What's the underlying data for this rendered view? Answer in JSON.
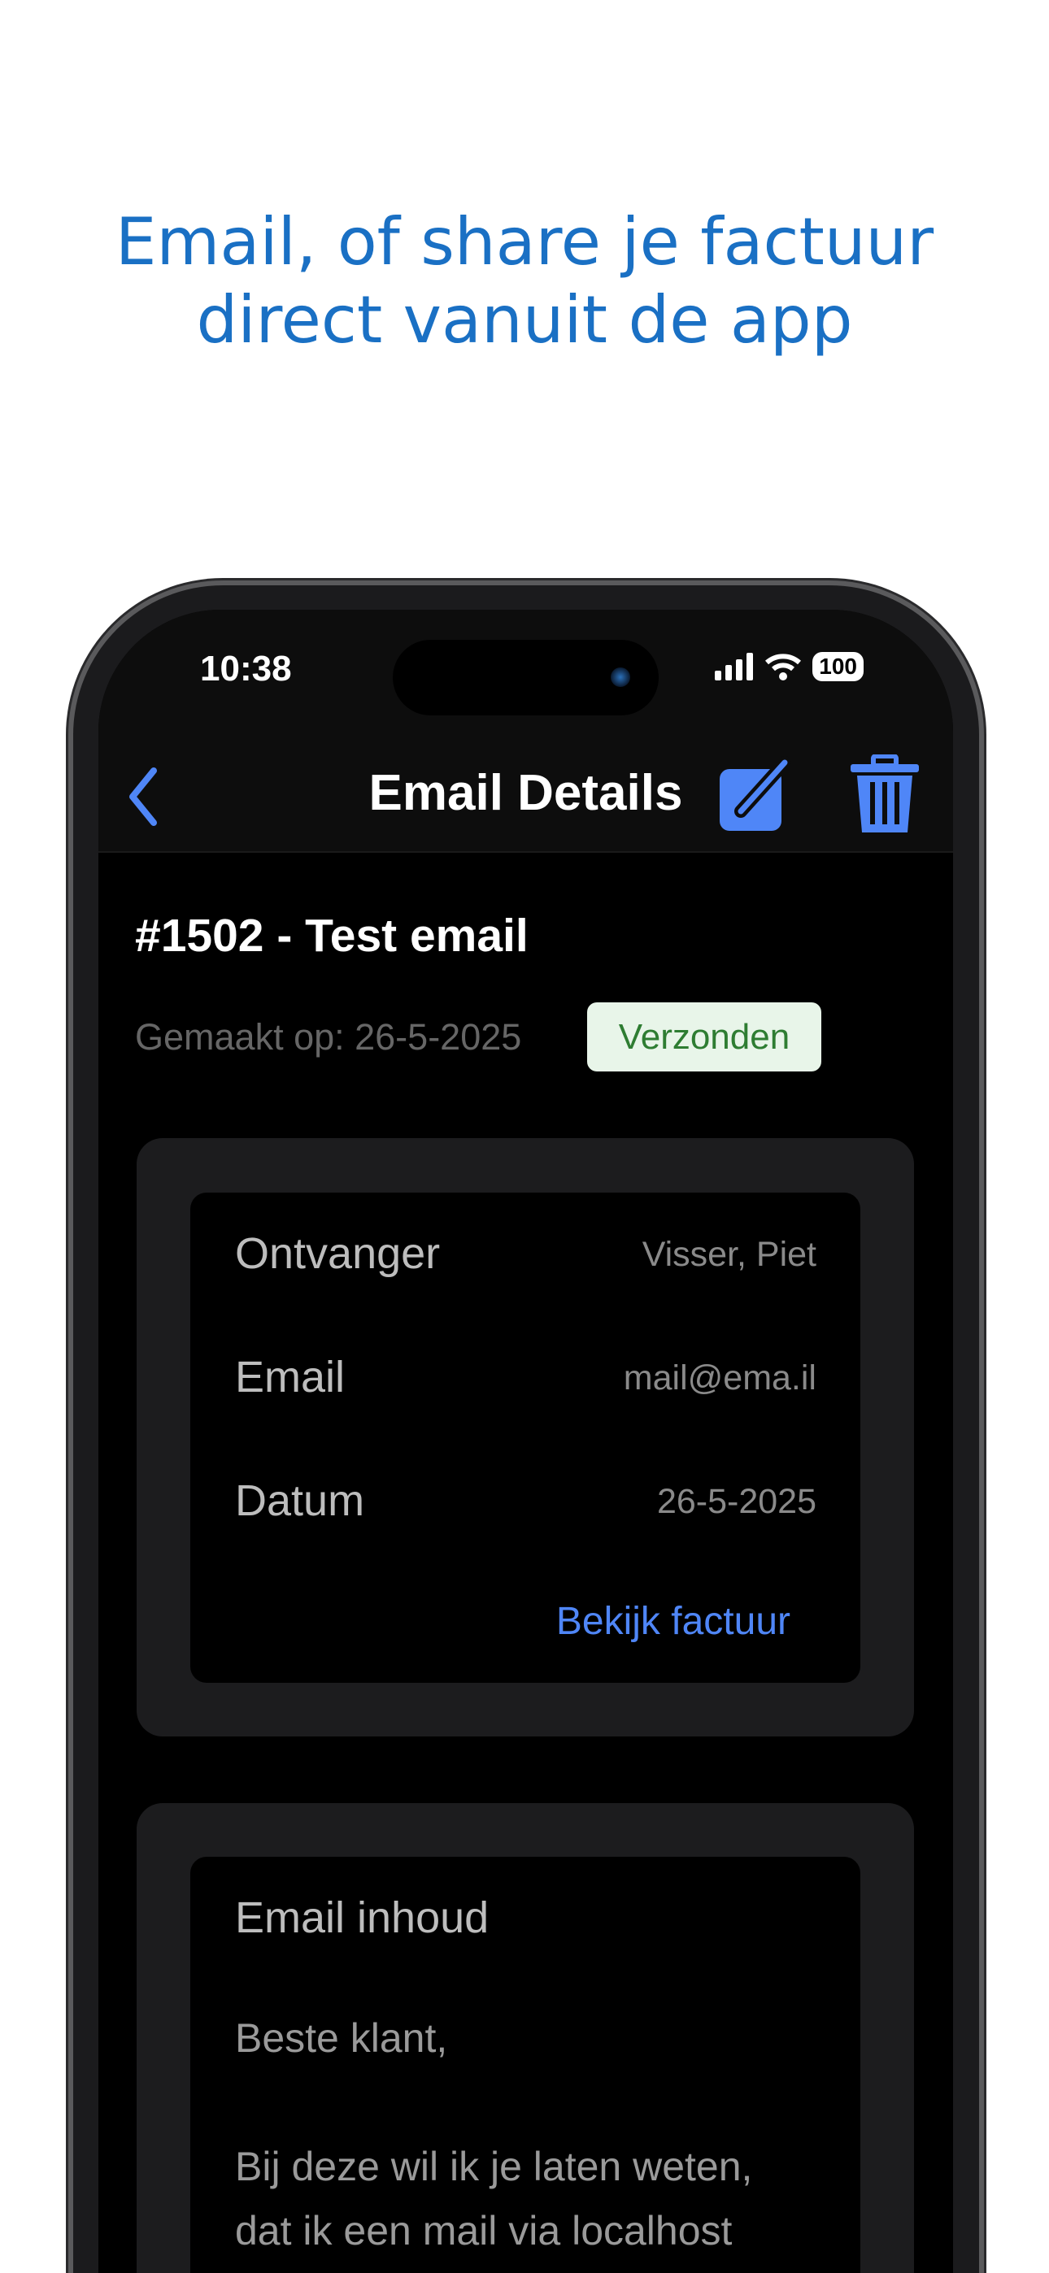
{
  "headline": {
    "line1": "Email, of share je factuur",
    "line2": "direct vanuit de app"
  },
  "status_bar": {
    "time": "10:38",
    "battery": "100"
  },
  "nav": {
    "title": "Email Details",
    "back_icon": "chevron-left-icon",
    "edit_icon": "square-pencil-icon",
    "delete_icon": "trash-icon"
  },
  "email": {
    "title": "#1502 - Test email",
    "created": "Gemaakt op: 26-5-2025",
    "status": "Verzonden",
    "details": [
      {
        "label": "Ontvanger",
        "value": "Visser, Piet"
      },
      {
        "label": "Email",
        "value": "mail@ema.il"
      },
      {
        "label": "Datum",
        "value": "26-5-2025"
      }
    ],
    "view_invoice": "Bekijk factuur",
    "content_heading": "Email inhoud",
    "content_greeting": "Beste klant,",
    "content_line1": "Bij deze wil ik je laten weten,",
    "content_line2": "dat ik een mail via localhost"
  },
  "colors": {
    "accent": "#4f86f7",
    "headline": "#1a70c4",
    "badge_bg": "#e8f5e9",
    "badge_text": "#2e7d32"
  }
}
